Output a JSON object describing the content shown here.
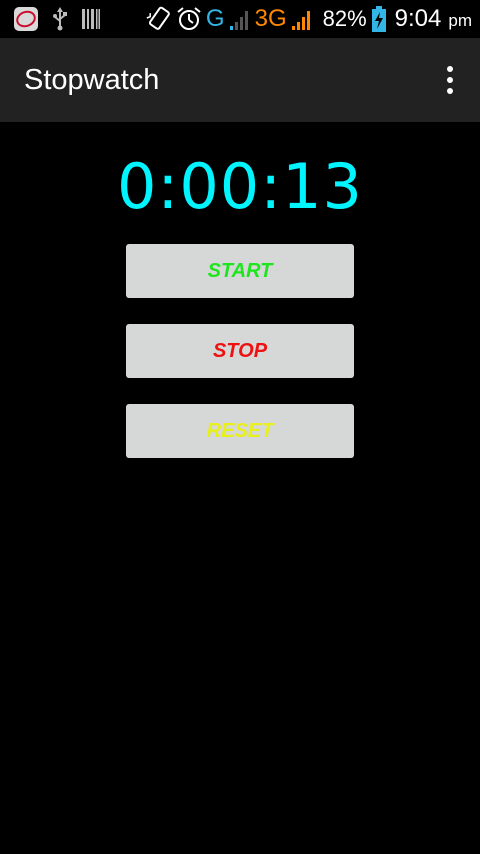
{
  "status_bar": {
    "network_g": "G",
    "network_3g": "3G",
    "battery_percent": "82%",
    "time": "9:04",
    "ampm": "pm",
    "colors": {
      "g": "#33b5e5",
      "threeg": "#ff8800"
    },
    "icons": [
      "notification-app-icon",
      "usb-icon",
      "barcode-icon",
      "vibrate-icon",
      "alarm-icon",
      "signal-icon",
      "signal-icon",
      "battery-charging-icon"
    ]
  },
  "action_bar": {
    "title": "Stopwatch",
    "overflow_icon": "more-vert-icon"
  },
  "stopwatch": {
    "display": "0:00:13",
    "display_color": "#00f5ff"
  },
  "buttons": {
    "start_label": "START",
    "stop_label": "STOP",
    "reset_label": "RESET",
    "colors": {
      "start": "#1ee51e",
      "stop": "#ee1111",
      "reset": "#e8f01a",
      "background": "#d6d7d7"
    }
  }
}
